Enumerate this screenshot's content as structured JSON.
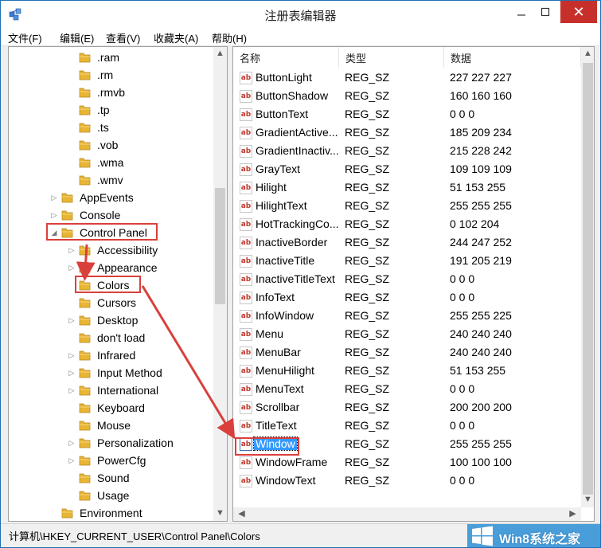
{
  "window": {
    "title": "注册表编辑器",
    "close_glyph": "✕"
  },
  "menu": [
    "文件(F)",
    "编辑(E)",
    "查看(V)",
    "收藏夹(A)",
    "帮助(H)"
  ],
  "tree": [
    {
      "label": ".ram",
      "level": 2,
      "expander": ""
    },
    {
      "label": ".rm",
      "level": 2,
      "expander": ""
    },
    {
      "label": ".rmvb",
      "level": 2,
      "expander": ""
    },
    {
      "label": ".tp",
      "level": 2,
      "expander": ""
    },
    {
      "label": ".ts",
      "level": 2,
      "expander": ""
    },
    {
      "label": ".vob",
      "level": 2,
      "expander": ""
    },
    {
      "label": ".wma",
      "level": 2,
      "expander": ""
    },
    {
      "label": ".wmv",
      "level": 2,
      "expander": ""
    },
    {
      "label": "AppEvents",
      "level": 1,
      "expander": "▷"
    },
    {
      "label": "Console",
      "level": 1,
      "expander": "▷"
    },
    {
      "label": "Control Panel",
      "level": 1,
      "expander": "◢"
    },
    {
      "label": "Accessibility",
      "level": 2,
      "expander": "▷"
    },
    {
      "label": "Appearance",
      "level": 2,
      "expander": "▷"
    },
    {
      "label": "Colors",
      "level": 2,
      "expander": ""
    },
    {
      "label": "Cursors",
      "level": 2,
      "expander": ""
    },
    {
      "label": "Desktop",
      "level": 2,
      "expander": "▷"
    },
    {
      "label": "don't load",
      "level": 2,
      "expander": ""
    },
    {
      "label": "Infrared",
      "level": 2,
      "expander": "▷"
    },
    {
      "label": "Input Method",
      "level": 2,
      "expander": "▷"
    },
    {
      "label": "International",
      "level": 2,
      "expander": "▷"
    },
    {
      "label": "Keyboard",
      "level": 2,
      "expander": ""
    },
    {
      "label": "Mouse",
      "level": 2,
      "expander": ""
    },
    {
      "label": "Personalization",
      "level": 2,
      "expander": "▷"
    },
    {
      "label": "PowerCfg",
      "level": 2,
      "expander": "▷"
    },
    {
      "label": "Sound",
      "level": 2,
      "expander": ""
    },
    {
      "label": "Usage",
      "level": 2,
      "expander": ""
    },
    {
      "label": "Environment",
      "level": 1,
      "expander": ""
    }
  ],
  "columns": {
    "name": "名称",
    "type": "类型",
    "data": "数据"
  },
  "values": [
    {
      "name": "ButtonLight",
      "type": "REG_SZ",
      "data": "227 227 227"
    },
    {
      "name": "ButtonShadow",
      "type": "REG_SZ",
      "data": "160 160 160"
    },
    {
      "name": "ButtonText",
      "type": "REG_SZ",
      "data": "0 0 0"
    },
    {
      "name": "GradientActive...",
      "type": "REG_SZ",
      "data": "185 209 234"
    },
    {
      "name": "GradientInactiv...",
      "type": "REG_SZ",
      "data": "215 228 242"
    },
    {
      "name": "GrayText",
      "type": "REG_SZ",
      "data": "109 109 109"
    },
    {
      "name": "Hilight",
      "type": "REG_SZ",
      "data": "51 153 255"
    },
    {
      "name": "HilightText",
      "type": "REG_SZ",
      "data": "255 255 255"
    },
    {
      "name": "HotTrackingCo...",
      "type": "REG_SZ",
      "data": "0 102 204"
    },
    {
      "name": "InactiveBorder",
      "type": "REG_SZ",
      "data": "244 247 252"
    },
    {
      "name": "InactiveTitle",
      "type": "REG_SZ",
      "data": "191 205 219"
    },
    {
      "name": "InactiveTitleText",
      "type": "REG_SZ",
      "data": "0 0 0"
    },
    {
      "name": "InfoText",
      "type": "REG_SZ",
      "data": "0 0 0"
    },
    {
      "name": "InfoWindow",
      "type": "REG_SZ",
      "data": "255 255 225"
    },
    {
      "name": "Menu",
      "type": "REG_SZ",
      "data": "240 240 240"
    },
    {
      "name": "MenuBar",
      "type": "REG_SZ",
      "data": "240 240 240"
    },
    {
      "name": "MenuHilight",
      "type": "REG_SZ",
      "data": "51 153 255"
    },
    {
      "name": "MenuText",
      "type": "REG_SZ",
      "data": "0 0 0"
    },
    {
      "name": "Scrollbar",
      "type": "REG_SZ",
      "data": "200 200 200"
    },
    {
      "name": "TitleText",
      "type": "REG_SZ",
      "data": "0 0 0"
    },
    {
      "name": "Window",
      "type": "REG_SZ",
      "data": "255 255 255",
      "selected": true
    },
    {
      "name": "WindowFrame",
      "type": "REG_SZ",
      "data": "100 100 100"
    },
    {
      "name": "WindowText",
      "type": "REG_SZ",
      "data": "0 0 0"
    }
  ],
  "status": {
    "path": "计算机\\HKEY_CURRENT_USER\\Control Panel\\Colors",
    "watermark": "Win8系统之家"
  },
  "colors": {
    "selection": "#3399ff",
    "annotation": "#d9403b",
    "folder": "#e8b535",
    "close": "#c7302a"
  },
  "icons": {
    "app": "registry-editor-icon",
    "folder": "folder-icon",
    "value": "reg-sz-ab-icon",
    "expand": "triangle-expand-icon",
    "logo": "windows-logo-icon"
  }
}
